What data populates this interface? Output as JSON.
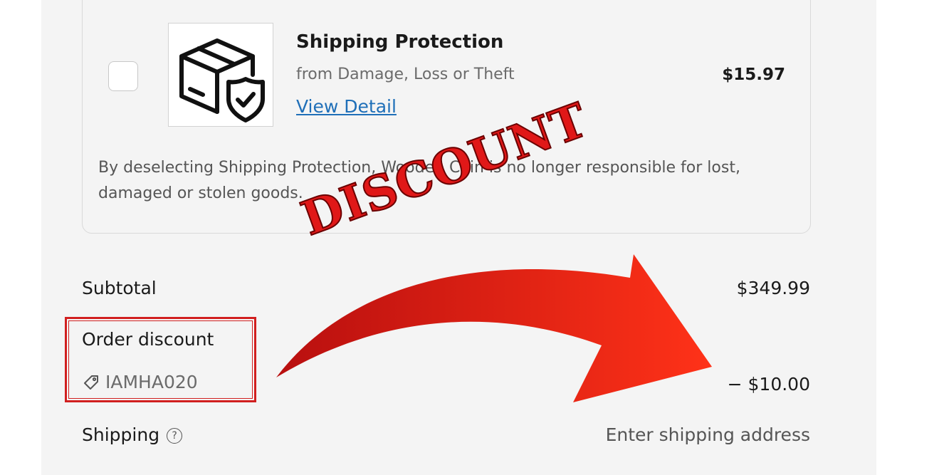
{
  "card": {
    "title": "Shipping Protection",
    "subtitle": "from Damage, Loss or Theft",
    "link": "View Detail",
    "price": "$15.97",
    "disclaimer": "By deselecting Shipping Protection, Wooden Coin is no longer responsible for lost, damaged or stolen goods.",
    "checked": false,
    "icon": "package-shield-icon"
  },
  "summary": {
    "subtotal_label": "Subtotal",
    "subtotal_value": "$349.99",
    "discount_label": "Order discount",
    "discount_code": "IAMHA020",
    "discount_value": "− $10.00",
    "shipping_label": "Shipping",
    "shipping_value": "Enter shipping address"
  },
  "overlay": {
    "watermark": "DISCOUNT",
    "accent_color": "#e01818",
    "highlight_color": "#d11f1f"
  }
}
